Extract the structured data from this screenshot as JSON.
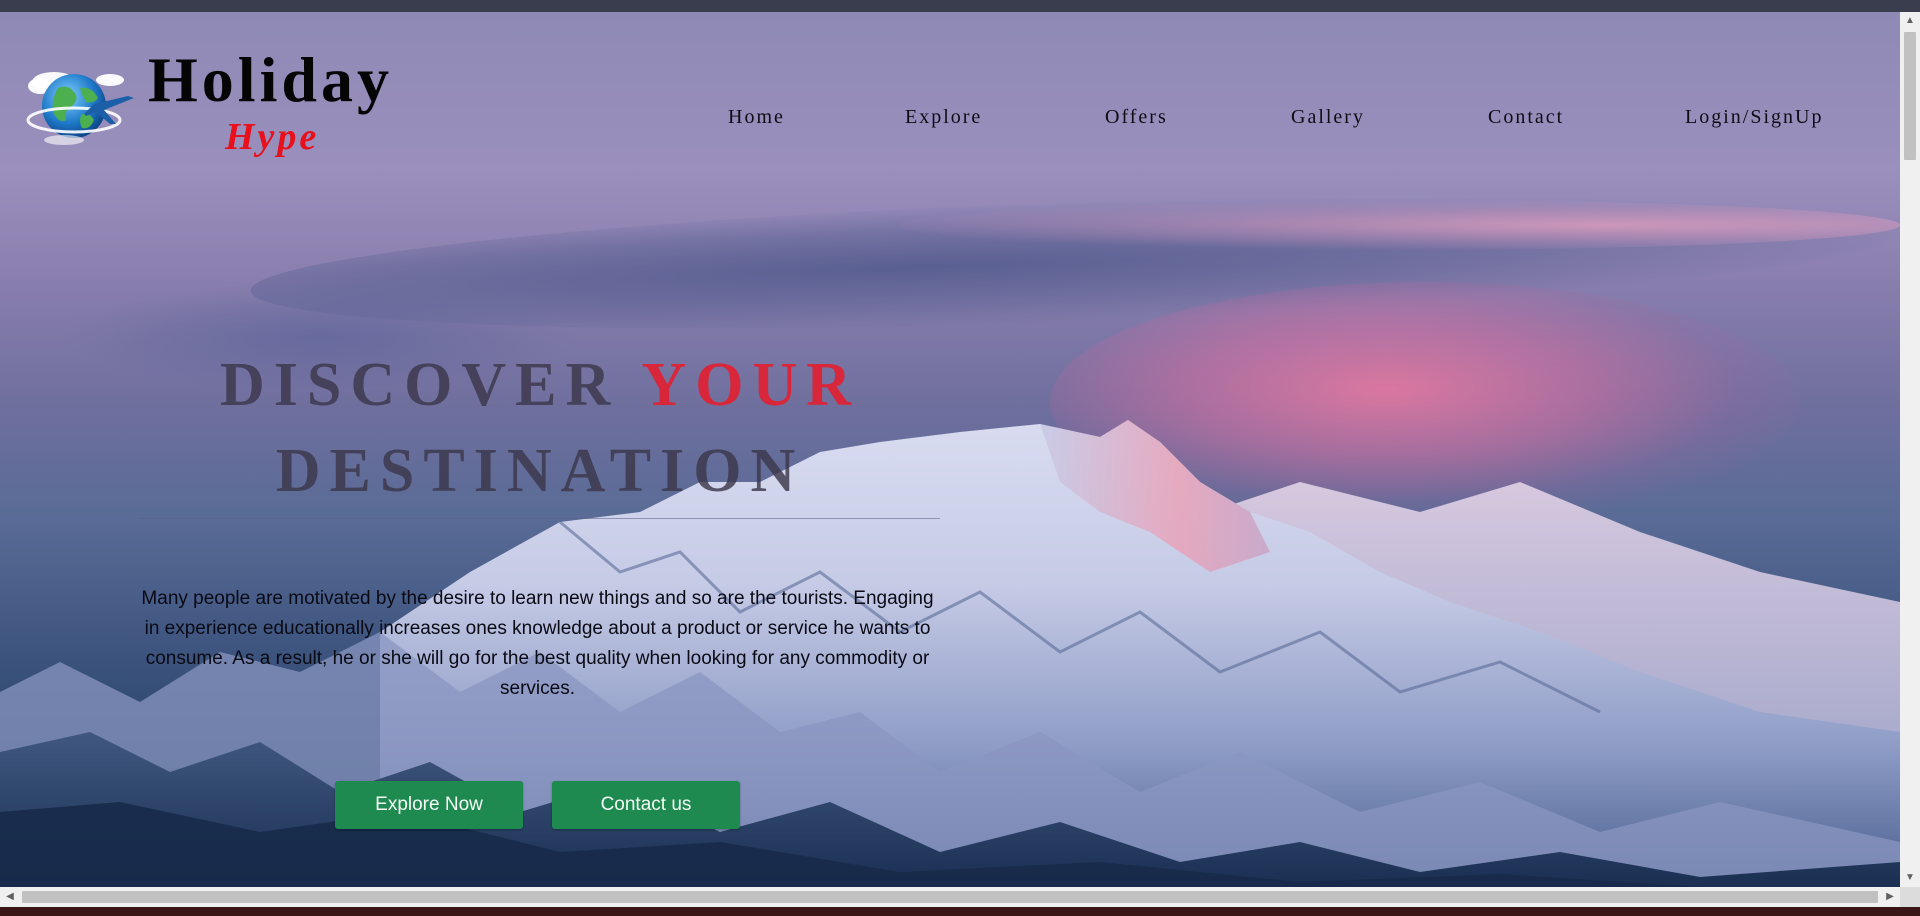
{
  "brand": {
    "title": "Holiday",
    "subtitle": "Hype",
    "logo_icon": "globe-airplane-icon"
  },
  "nav": {
    "items": [
      {
        "label": "Home"
      },
      {
        "label": "Explore"
      },
      {
        "label": "Offers"
      },
      {
        "label": "Gallery"
      },
      {
        "label": "Contact"
      },
      {
        "label": "Login/SignUp"
      }
    ]
  },
  "hero": {
    "title_part1": "DISCOVER",
    "title_accent": "YOUR",
    "title_line2": "DESTINATION",
    "description": "Many people are motivated by the desire to learn new things and so are the tourists. Engaging in experience educationally increases ones knowledge about a product or service he wants to consume. As a result, he or she will go for the best quality when looking for any commodity or services.",
    "primary_button": "Explore Now",
    "secondary_button": "Contact us"
  },
  "colors": {
    "accent_red": "#e8101a",
    "button_green": "#1e8a50",
    "title_text": "#050505"
  },
  "scrollbars": {
    "up_icon": "▲",
    "down_icon": "▼",
    "left_icon": "◀",
    "right_icon": "▶"
  }
}
